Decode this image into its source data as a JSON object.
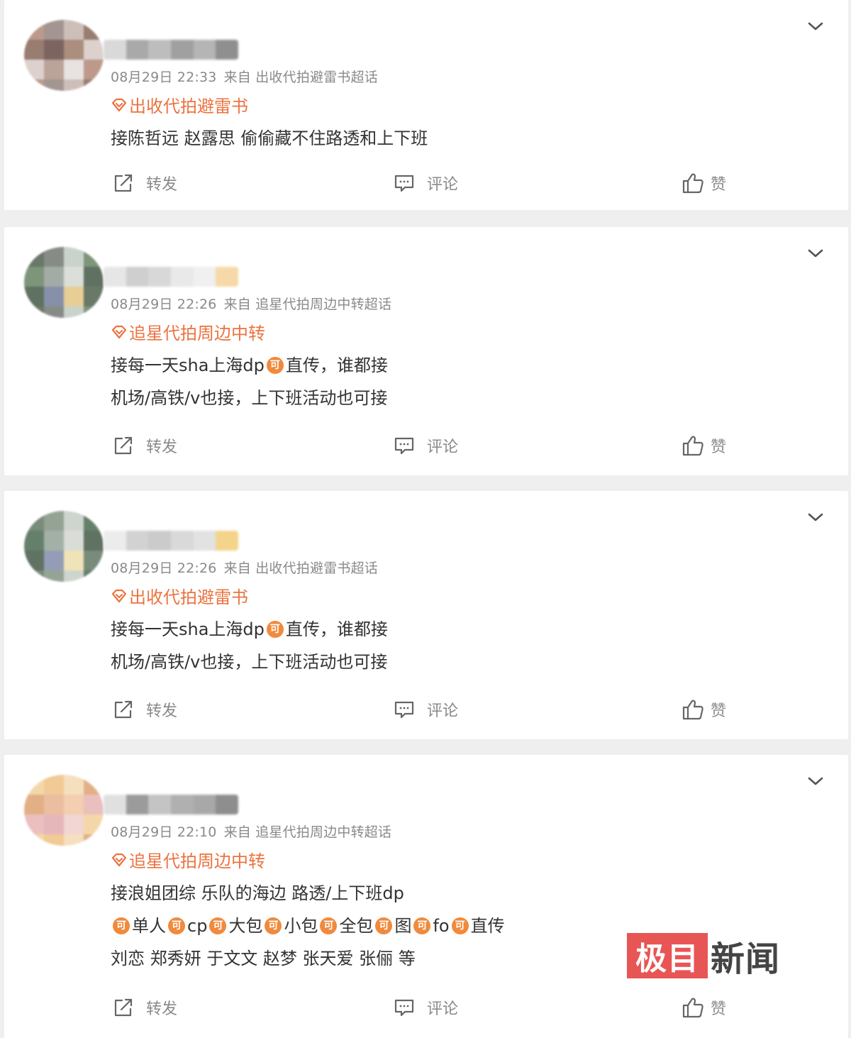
{
  "posts": [
    {
      "meta_time": "08月29日 22:33",
      "meta_source": "来自 出收代拍避雷书超话",
      "topic": "出收代拍避雷书",
      "lines": [
        [
          {
            "t": "接陈哲远 赵露思 偷偷藏不住路透和上下班"
          }
        ]
      ],
      "repost": "转发",
      "comment": "评论",
      "like": "赞"
    },
    {
      "meta_time": "08月29日 22:26",
      "meta_source": "来自 追星代拍周边中转超话",
      "topic": "追星代拍周边中转",
      "lines": [
        [
          {
            "t": "接每一天sha上海dp"
          },
          {
            "k": "可"
          },
          {
            "t": "直传，谁都接"
          }
        ],
        [
          {
            "t": "机场/高铁/v也接，上下班活动也可接"
          }
        ]
      ],
      "repost": "转发",
      "comment": "评论",
      "like": "赞"
    },
    {
      "meta_time": "08月29日 22:26",
      "meta_source": "来自 出收代拍避雷书超话",
      "topic": "出收代拍避雷书",
      "lines": [
        [
          {
            "t": "接每一天sha上海dp"
          },
          {
            "k": "可"
          },
          {
            "t": "直传，谁都接"
          }
        ],
        [
          {
            "t": "机场/高铁/v也接，上下班活动也可接"
          }
        ]
      ],
      "repost": "转发",
      "comment": "评论",
      "like": "赞"
    },
    {
      "meta_time": "08月29日 22:10",
      "meta_source": "来自 追星代拍周边中转超话",
      "topic": "追星代拍周边中转",
      "lines": [
        [
          {
            "t": "接浪姐团综 乐队的海边 路透/上下班dp"
          }
        ],
        [
          {
            "k": "可"
          },
          {
            "t": "单人"
          },
          {
            "k": "可"
          },
          {
            "t": "cp"
          },
          {
            "k": "可"
          },
          {
            "t": "大包"
          },
          {
            "k": "可"
          },
          {
            "t": "小包"
          },
          {
            "k": "可"
          },
          {
            "t": "全包"
          },
          {
            "k": "可"
          },
          {
            "t": "图"
          },
          {
            "k": "可"
          },
          {
            "t": "fo"
          },
          {
            "k": "可"
          },
          {
            "t": "直传"
          }
        ],
        [
          {
            "t": "刘恋 郑秀妍 于文文 赵梦 张天爱 张俪 等"
          }
        ]
      ],
      "repost": "转发",
      "comment": "评论",
      "like": "赞"
    }
  ],
  "watermark": {
    "brand_box": "极目",
    "brand_text": "新闻"
  },
  "colors": {
    "topic": "#eb7340",
    "ke_badge": "#f08a3c",
    "meta": "#8a8a8a",
    "body": "#333333",
    "background": "#efefef",
    "watermark_box": "#e85555"
  },
  "icons": {
    "chevron": "chevron-down-icon",
    "topic": "diamond-topic-icon",
    "repost": "share-icon",
    "comment": "comment-icon",
    "like": "thumbs-up-icon",
    "ke": "ke-badge-icon"
  }
}
